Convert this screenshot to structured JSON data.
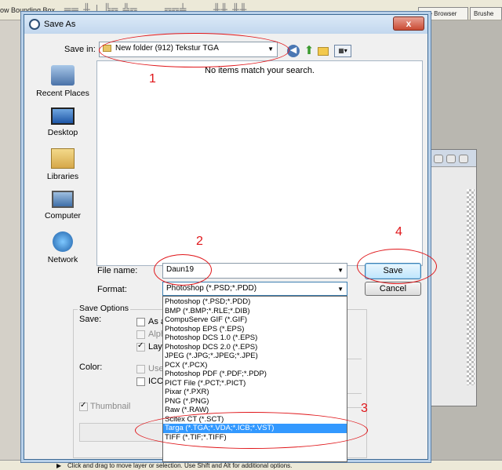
{
  "ps": {
    "bbox_label": "ow Bounding Box",
    "tab_file_browser": "File Browser",
    "tab_brush": "Brushe",
    "status": "Click and drag to move layer or selection.  Use Shift and Alt for additional options."
  },
  "dialog": {
    "title": "Save As",
    "close": "x",
    "save_in_label": "Save in:",
    "save_in_value": "New folder (912) Tekstur TGA",
    "places": [
      "Recent Places",
      "Desktop",
      "Libraries",
      "Computer",
      "Network"
    ],
    "empty_text": "No items match your search.",
    "file_name_label": "File name:",
    "file_name_value": "Daun19",
    "format_label": "Format:",
    "format_value": "Photoshop (*.PSD;*.PDD)",
    "save_button": "Save",
    "cancel_button": "Cancel",
    "save_options_label": "Save Options",
    "save_label": "Save:",
    "opt_as_copy": "As a",
    "opt_alpha": "Alph",
    "opt_layers": "Laye",
    "color_label": "Color:",
    "opt_use": "Use",
    "opt_icc": "ICC",
    "thumbnail_label": "Thumbnail"
  },
  "format_options": [
    "Photoshop (*.PSD;*.PDD)",
    "BMP (*.BMP;*.RLE;*.DIB)",
    "CompuServe GIF (*.GIF)",
    "Photoshop EPS (*.EPS)",
    "Photoshop DCS 1.0 (*.EPS)",
    "Photoshop DCS 2.0 (*.EPS)",
    "JPEG (*.JPG;*.JPEG;*.JPE)",
    "PCX (*.PCX)",
    "Photoshop PDF (*.PDF;*.PDP)",
    "PICT File (*.PCT;*.PICT)",
    "Pixar (*.PXR)",
    "PNG (*.PNG)",
    "Raw (*.RAW)",
    "Scitex CT (*.SCT)",
    "Targa (*.TGA;*.VDA;*.ICB;*.VST)",
    "TIFF (*.TIF;*.TIFF)"
  ],
  "annotations": [
    "1",
    "2",
    "3",
    "4"
  ],
  "colors": {
    "annotation": "#e0161a",
    "selection": "#3399ff"
  }
}
